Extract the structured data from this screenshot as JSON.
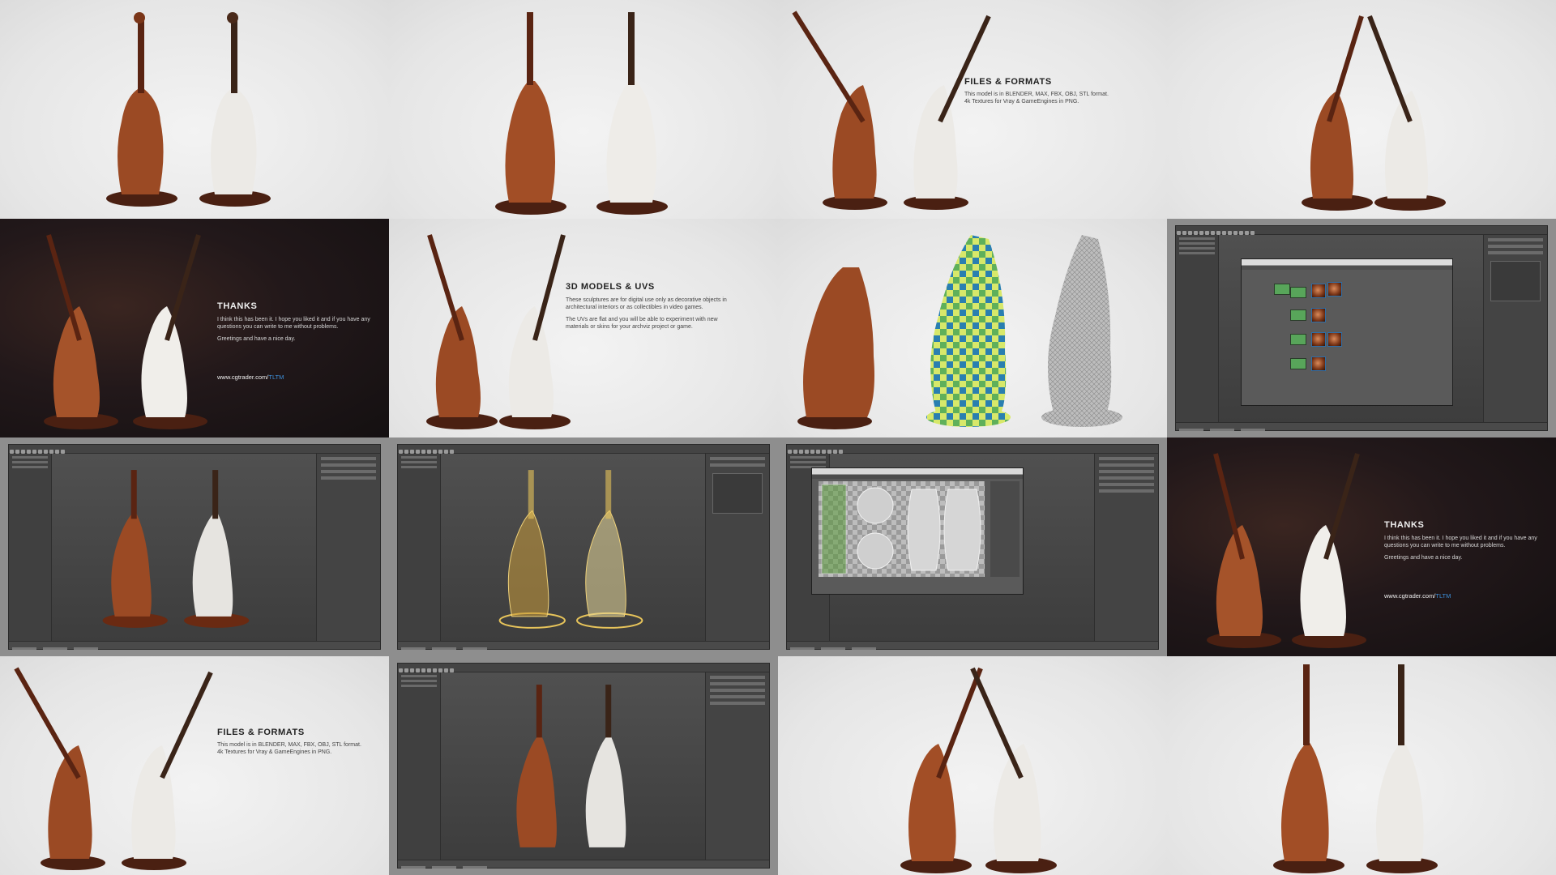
{
  "colors": {
    "wood": "#9b4a24",
    "wood_dark": "#5a2412",
    "marble": "#eceae6",
    "base": "#4a2012",
    "dark_bg": "#1c1416",
    "accent_link": "#3d8fd9",
    "editor_bg": "#3a3a3a",
    "uv_green": "#5a9a3a",
    "wire_gold": "#e6c35a"
  },
  "slides": {
    "files_formats": {
      "title": "FILES & FORMATS",
      "line1": "This model is in BLENDER, MAX, FBX, OBJ, STL format.",
      "line2": "4k Textures for Vray & GameEngines in PNG."
    },
    "thanks": {
      "title": "THANKS",
      "p1": "I think this has been it. I hope you liked it and if you have any questions you can write to me without problems.",
      "p2": "Greetings and have a nice day.",
      "link_prefix": "www.cgtrader.com/",
      "link_accent": "TLTM"
    },
    "models_uvs": {
      "title": "3D MODELS & UVs",
      "p1": "These sculptures are for digital use only as decorative objects in architectural interiors or as collectibles in video games.",
      "p2": "The UVs are flat and you will be able to experiment with new materials or skins for your archviz project or game."
    }
  },
  "icons": [
    "toolbar-icon",
    "node-icon",
    "material-thumbnail-icon",
    "checker-icon"
  ]
}
